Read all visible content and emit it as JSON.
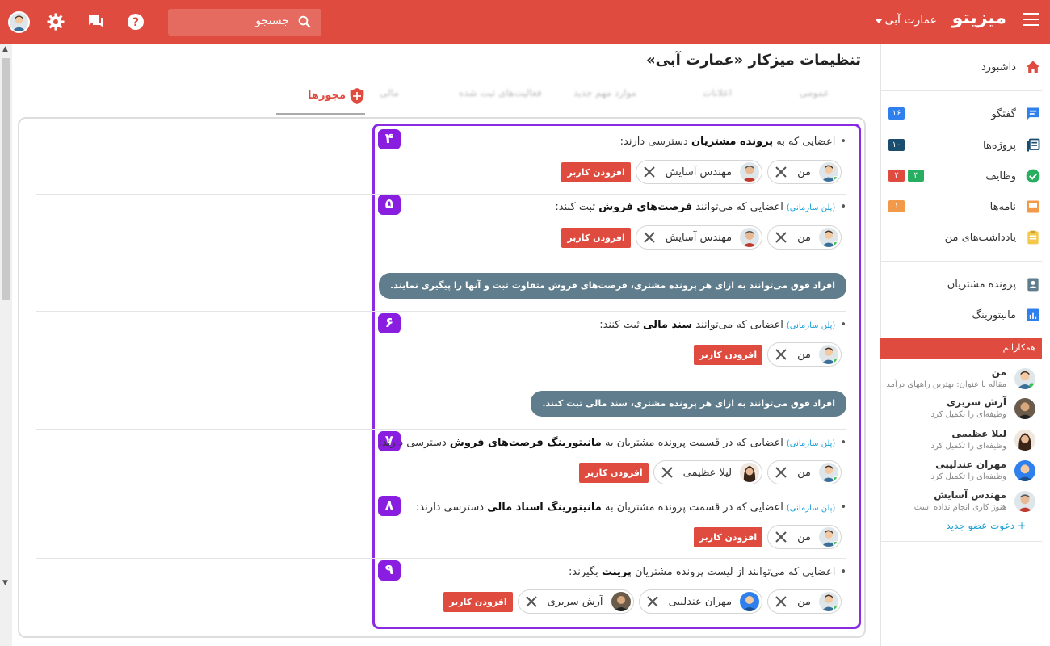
{
  "topbar": {
    "brand": "میزیتو",
    "workspace": "عمارت آبی",
    "search_placeholder": "جستجو"
  },
  "sidebar": {
    "items": [
      {
        "label": "داشبورد",
        "icon": "home-icon"
      },
      {
        "label": "گفتگو",
        "icon": "chat-icon",
        "badges": [
          {
            "text": "۱۶",
            "color": "#2f80ed"
          }
        ]
      },
      {
        "label": "پروژه‌ها",
        "icon": "projects-icon",
        "badges": [
          {
            "text": "۱۰",
            "color": "#1a4d6e"
          }
        ]
      },
      {
        "label": "وظایف",
        "icon": "tasks-icon",
        "badges": [
          {
            "text": "۳",
            "color": "#27ae60"
          },
          {
            "text": "۲",
            "color": "#e04b3f"
          }
        ]
      },
      {
        "label": "نامه‌ها",
        "icon": "inbox-icon",
        "badges": [
          {
            "text": "۱",
            "color": "#f2994a"
          }
        ]
      },
      {
        "label": "یادداشت‌های من",
        "icon": "notes-icon"
      },
      {
        "label": "پرونده مشتریان",
        "icon": "contacts-icon"
      },
      {
        "label": "مانیتورینگ",
        "icon": "chart-icon"
      }
    ],
    "colleagues_title": "همکارانم",
    "colleagues": [
      {
        "name": "من",
        "status": "مقاله با عنوان: بهترین راههای درآمد"
      },
      {
        "name": "آرش سریری",
        "status": "وظیفه‌ای را تکمیل کرد"
      },
      {
        "name": "لیلا عظیمی",
        "status": "وظیفه‌ای را تکمیل کرد"
      },
      {
        "name": "مهران عندلیبی",
        "status": "وظیفه‌ای را تکمیل کرد"
      },
      {
        "name": "مهندس آسایش",
        "status": "هنوز کاری انجام نداده است"
      }
    ],
    "invite": "دعوت عضو جدید"
  },
  "page": {
    "title": "تنظیمات میزکار «عمارت آبی»",
    "tabs": [
      "مجوزها",
      "مالی",
      "فعالیت‌های ثبت شده",
      "موارد مهم جدید",
      "اعلانات",
      "عمومی"
    ],
    "active_tab": "مجوزها"
  },
  "permissions": {
    "add_user": "افزودن کاربر",
    "org_plan": "(پلن سازمانی)",
    "p4": {
      "num": "۴",
      "pre": "اعضایی که به ",
      "bold": "پرونده مشتریان",
      "post": " دسترسی دارند:",
      "users": [
        "من",
        "مهندس آسایش"
      ]
    },
    "p5": {
      "num": "۵",
      "pre": "اعضایی که می‌توانند ",
      "bold": "فرصت‌های فروش",
      "post": " ثبت کنند:",
      "users": [
        "من",
        "مهندس آسایش"
      ],
      "note": "افراد فوق می‌توانند به ازای هر پرونده مشتری، فرصت‌های فروش متفاوت ثبت و آنها را پیگیری نمایند."
    },
    "p6": {
      "num": "۶",
      "pre": "اعضایی که می‌توانند ",
      "bold": "سند مالی",
      "post": " ثبت کنند:",
      "users": [
        "من"
      ],
      "note": "افراد فوق می‌توانند به ازای هر پرونده مشتری، سند مالی ثبت کنند."
    },
    "p7": {
      "num": "۷",
      "pre": "اعضایی که در قسمت پرونده مشتریان به ",
      "bold": "مانیتورینگ فرصت‌های فروش",
      "post": " دسترسی دارند:",
      "users": [
        "من",
        "لیلا عظیمی"
      ]
    },
    "p8": {
      "num": "۸",
      "pre": "اعضایی که در قسمت پرونده مشتریان به ",
      "bold": "مانیتورینگ اسناد مالی",
      "post": " دسترسی دارند:",
      "users": [
        "من"
      ]
    },
    "p9": {
      "num": "۹",
      "pre": "اعضایی که می‌توانند از لیست پرونده مشتریان ",
      "bold": "پرینت",
      "post": " بگیرند:",
      "users": [
        "من",
        "مهران عندلیبی",
        "آرش سریری"
      ]
    }
  }
}
